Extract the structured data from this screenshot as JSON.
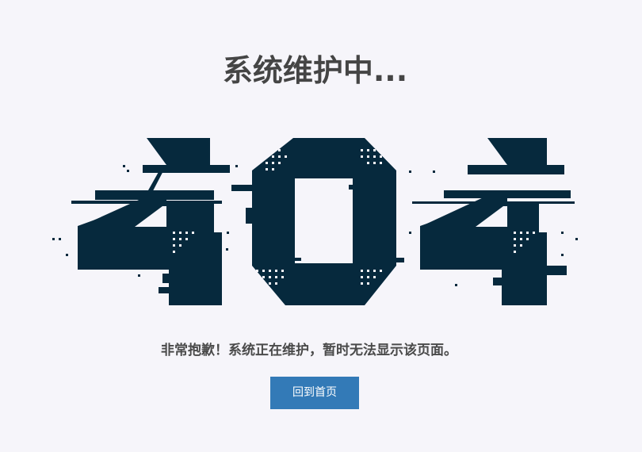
{
  "page": {
    "title": "系统维护中...",
    "message": "非常抱歉！系统正在维护，暂时无法显示该页面。",
    "home_button_label": "回到首页"
  },
  "illustration": {
    "code": "404",
    "color": "#06293d"
  },
  "colors": {
    "background": "#f6f5fa",
    "title": "#454545",
    "button": "#337ab7",
    "button_text": "#ffffff"
  }
}
